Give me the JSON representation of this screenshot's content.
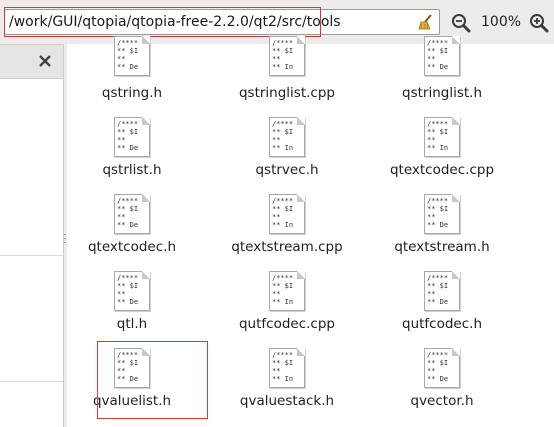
{
  "location": {
    "path": "/work/GUI/qtopia/qtopia-free-2.2.0/qt2/src/tools"
  },
  "zoom": {
    "level": "100%"
  },
  "icons": {
    "clear": "broom-icon",
    "zoom_out": "zoom-out-icon",
    "zoom_in": "zoom-in-icon",
    "close": "close-icon",
    "file": "text-file-icon"
  },
  "colors": {
    "highlight": "#d43a3a",
    "background": "#edeceb"
  },
  "file_preview": {
    "line1": "/****",
    "line2": "** $I",
    "line3": "**",
    "line4": "** De",
    "line4_alt": "** In"
  },
  "files": [
    {
      "name": "qstring.h"
    },
    {
      "name": "qstringlist.cpp"
    },
    {
      "name": "qstringlist.h"
    },
    {
      "name": "qstrlist.h"
    },
    {
      "name": "qstrvec.h"
    },
    {
      "name": "qtextcodec.cpp"
    },
    {
      "name": "qtextcodec.h"
    },
    {
      "name": "qtextstream.cpp"
    },
    {
      "name": "qtextstream.h"
    },
    {
      "name": "qtl.h"
    },
    {
      "name": "qutfcodec.cpp"
    },
    {
      "name": "qutfcodec.h"
    },
    {
      "name": "qvaluelist.h"
    },
    {
      "name": "qvaluestack.h"
    },
    {
      "name": "qvector.h"
    }
  ]
}
